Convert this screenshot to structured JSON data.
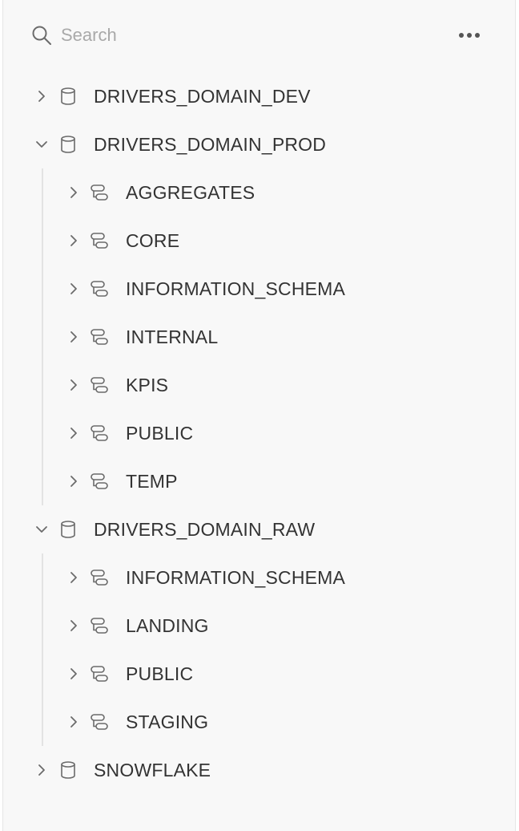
{
  "search": {
    "placeholder": "Search",
    "icon": "search-icon",
    "more_icon": "more-horizontal-icon"
  },
  "colors": {
    "panel_bg": "#f8f8f8",
    "text": "#333333",
    "icon": "#6b6b6b",
    "placeholder": "#a9a9a9",
    "guide": "#e3e3e3"
  },
  "tree": [
    {
      "label": "DRIVERS_DOMAIN_DEV",
      "type": "database",
      "expanded": false,
      "children": []
    },
    {
      "label": "DRIVERS_DOMAIN_PROD",
      "type": "database",
      "expanded": true,
      "children": [
        {
          "label": "AGGREGATES",
          "type": "schema",
          "expanded": false
        },
        {
          "label": "CORE",
          "type": "schema",
          "expanded": false
        },
        {
          "label": "INFORMATION_SCHEMA",
          "type": "schema",
          "expanded": false
        },
        {
          "label": "INTERNAL",
          "type": "schema",
          "expanded": false
        },
        {
          "label": "KPIS",
          "type": "schema",
          "expanded": false
        },
        {
          "label": "PUBLIC",
          "type": "schema",
          "expanded": false
        },
        {
          "label": "TEMP",
          "type": "schema",
          "expanded": false
        }
      ]
    },
    {
      "label": "DRIVERS_DOMAIN_RAW",
      "type": "database",
      "expanded": true,
      "children": [
        {
          "label": "INFORMATION_SCHEMA",
          "type": "schema",
          "expanded": false
        },
        {
          "label": "LANDING",
          "type": "schema",
          "expanded": false
        },
        {
          "label": "PUBLIC",
          "type": "schema",
          "expanded": false
        },
        {
          "label": "STAGING",
          "type": "schema",
          "expanded": false
        }
      ]
    },
    {
      "label": "SNOWFLAKE",
      "type": "database",
      "expanded": false,
      "children": []
    }
  ]
}
